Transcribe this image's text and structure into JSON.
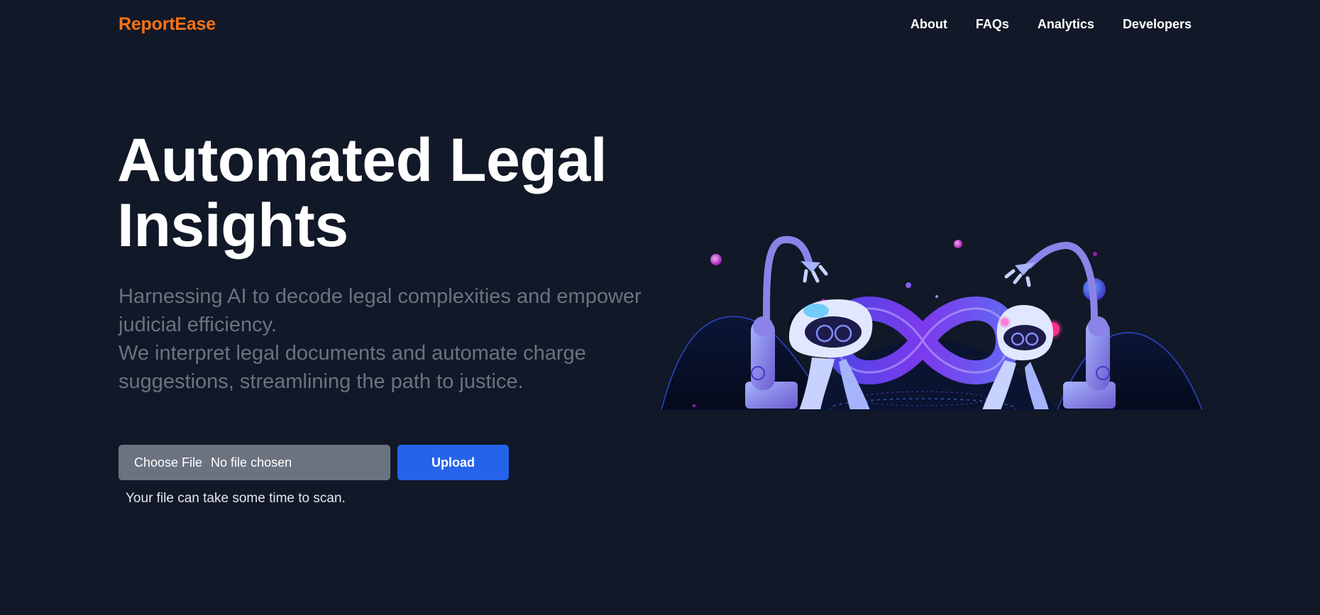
{
  "header": {
    "brand": "ReportEase",
    "nav": [
      "About",
      "FAQs",
      "Analytics",
      "Developers"
    ]
  },
  "hero": {
    "title": "Automated Legal Insights",
    "description_line1": "Harnessing AI to decode legal complexities and empower judicial efficiency.",
    "description_line2": "We interpret legal documents and automate charge suggestions, streamlining the path to justice."
  },
  "upload": {
    "choose_label": "Choose File",
    "file_status": "No file chosen",
    "button_label": "Upload",
    "note": "Your file can take some time to scan."
  },
  "illustration": {
    "icon": "robot-arms-infinity-illustration"
  },
  "colors": {
    "background": "#111827",
    "brand": "#f97316",
    "accent": "#2563eb",
    "muted_text": "#6b7280"
  }
}
